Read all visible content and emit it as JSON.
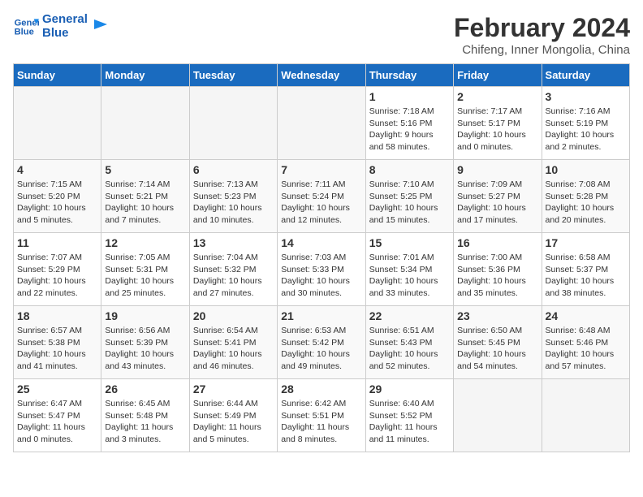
{
  "header": {
    "logo_line1": "General",
    "logo_line2": "Blue",
    "title": "February 2024",
    "subtitle": "Chifeng, Inner Mongolia, China"
  },
  "days_of_week": [
    "Sunday",
    "Monday",
    "Tuesday",
    "Wednesday",
    "Thursday",
    "Friday",
    "Saturday"
  ],
  "weeks": [
    [
      {
        "day": "",
        "info": ""
      },
      {
        "day": "",
        "info": ""
      },
      {
        "day": "",
        "info": ""
      },
      {
        "day": "",
        "info": ""
      },
      {
        "day": "1",
        "info": "Sunrise: 7:18 AM\nSunset: 5:16 PM\nDaylight: 9 hours\nand 58 minutes."
      },
      {
        "day": "2",
        "info": "Sunrise: 7:17 AM\nSunset: 5:17 PM\nDaylight: 10 hours\nand 0 minutes."
      },
      {
        "day": "3",
        "info": "Sunrise: 7:16 AM\nSunset: 5:19 PM\nDaylight: 10 hours\nand 2 minutes."
      }
    ],
    [
      {
        "day": "4",
        "info": "Sunrise: 7:15 AM\nSunset: 5:20 PM\nDaylight: 10 hours\nand 5 minutes."
      },
      {
        "day": "5",
        "info": "Sunrise: 7:14 AM\nSunset: 5:21 PM\nDaylight: 10 hours\nand 7 minutes."
      },
      {
        "day": "6",
        "info": "Sunrise: 7:13 AM\nSunset: 5:23 PM\nDaylight: 10 hours\nand 10 minutes."
      },
      {
        "day": "7",
        "info": "Sunrise: 7:11 AM\nSunset: 5:24 PM\nDaylight: 10 hours\nand 12 minutes."
      },
      {
        "day": "8",
        "info": "Sunrise: 7:10 AM\nSunset: 5:25 PM\nDaylight: 10 hours\nand 15 minutes."
      },
      {
        "day": "9",
        "info": "Sunrise: 7:09 AM\nSunset: 5:27 PM\nDaylight: 10 hours\nand 17 minutes."
      },
      {
        "day": "10",
        "info": "Sunrise: 7:08 AM\nSunset: 5:28 PM\nDaylight: 10 hours\nand 20 minutes."
      }
    ],
    [
      {
        "day": "11",
        "info": "Sunrise: 7:07 AM\nSunset: 5:29 PM\nDaylight: 10 hours\nand 22 minutes."
      },
      {
        "day": "12",
        "info": "Sunrise: 7:05 AM\nSunset: 5:31 PM\nDaylight: 10 hours\nand 25 minutes."
      },
      {
        "day": "13",
        "info": "Sunrise: 7:04 AM\nSunset: 5:32 PM\nDaylight: 10 hours\nand 27 minutes."
      },
      {
        "day": "14",
        "info": "Sunrise: 7:03 AM\nSunset: 5:33 PM\nDaylight: 10 hours\nand 30 minutes."
      },
      {
        "day": "15",
        "info": "Sunrise: 7:01 AM\nSunset: 5:34 PM\nDaylight: 10 hours\nand 33 minutes."
      },
      {
        "day": "16",
        "info": "Sunrise: 7:00 AM\nSunset: 5:36 PM\nDaylight: 10 hours\nand 35 minutes."
      },
      {
        "day": "17",
        "info": "Sunrise: 6:58 AM\nSunset: 5:37 PM\nDaylight: 10 hours\nand 38 minutes."
      }
    ],
    [
      {
        "day": "18",
        "info": "Sunrise: 6:57 AM\nSunset: 5:38 PM\nDaylight: 10 hours\nand 41 minutes."
      },
      {
        "day": "19",
        "info": "Sunrise: 6:56 AM\nSunset: 5:39 PM\nDaylight: 10 hours\nand 43 minutes."
      },
      {
        "day": "20",
        "info": "Sunrise: 6:54 AM\nSunset: 5:41 PM\nDaylight: 10 hours\nand 46 minutes."
      },
      {
        "day": "21",
        "info": "Sunrise: 6:53 AM\nSunset: 5:42 PM\nDaylight: 10 hours\nand 49 minutes."
      },
      {
        "day": "22",
        "info": "Sunrise: 6:51 AM\nSunset: 5:43 PM\nDaylight: 10 hours\nand 52 minutes."
      },
      {
        "day": "23",
        "info": "Sunrise: 6:50 AM\nSunset: 5:45 PM\nDaylight: 10 hours\nand 54 minutes."
      },
      {
        "day": "24",
        "info": "Sunrise: 6:48 AM\nSunset: 5:46 PM\nDaylight: 10 hours\nand 57 minutes."
      }
    ],
    [
      {
        "day": "25",
        "info": "Sunrise: 6:47 AM\nSunset: 5:47 PM\nDaylight: 11 hours\nand 0 minutes."
      },
      {
        "day": "26",
        "info": "Sunrise: 6:45 AM\nSunset: 5:48 PM\nDaylight: 11 hours\nand 3 minutes."
      },
      {
        "day": "27",
        "info": "Sunrise: 6:44 AM\nSunset: 5:49 PM\nDaylight: 11 hours\nand 5 minutes."
      },
      {
        "day": "28",
        "info": "Sunrise: 6:42 AM\nSunset: 5:51 PM\nDaylight: 11 hours\nand 8 minutes."
      },
      {
        "day": "29",
        "info": "Sunrise: 6:40 AM\nSunset: 5:52 PM\nDaylight: 11 hours\nand 11 minutes."
      },
      {
        "day": "",
        "info": ""
      },
      {
        "day": "",
        "info": ""
      }
    ]
  ]
}
